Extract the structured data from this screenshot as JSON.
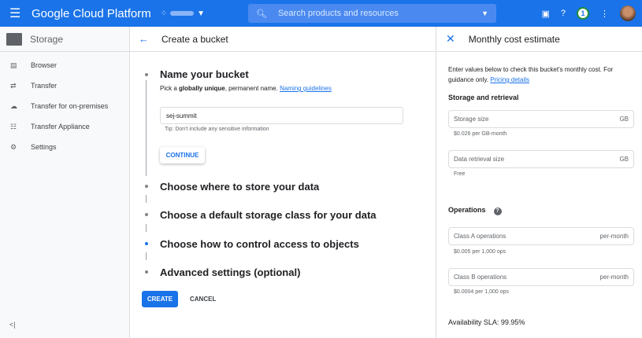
{
  "topbar": {
    "brand": "Google Cloud Platform",
    "search_placeholder": "Search products and resources",
    "notification_count": "1"
  },
  "sidebar": {
    "title": "Storage",
    "items": [
      {
        "label": "Browser",
        "icon": "bucket-icon"
      },
      {
        "label": "Transfer",
        "icon": "transfer-icon"
      },
      {
        "label": "Transfer for on-premises",
        "icon": "cloud-upload-icon"
      },
      {
        "label": "Transfer Appliance",
        "icon": "appliance-icon"
      },
      {
        "label": "Settings",
        "icon": "gear-icon"
      }
    ],
    "collapse": "<|"
  },
  "main": {
    "title": "Create a bucket",
    "steps": [
      "Name your bucket",
      "Choose where to store your data",
      "Choose a default storage class for your data",
      "Choose how to control access to objects",
      "Advanced settings (optional)"
    ],
    "subtitle_pre": "Pick a ",
    "subtitle_bold": "globally unique",
    "subtitle_post": ", permanent name. ",
    "naming_link": "Naming guidelines",
    "bucket_name": "sej-summit",
    "tip": "Tip: Don't include any sensitive information",
    "continue": "CONTINUE",
    "create": "CREATE",
    "cancel": "CANCEL"
  },
  "estimate": {
    "title": "Monthly cost estimate",
    "intro": "Enter values below to check this bucket's monthly cost. For guidance only. ",
    "pricing_link": "Pricing details",
    "storage_heading": "Storage and retrieval",
    "storage_size": "Storage size",
    "storage_unit": "GB",
    "storage_help": "$0.026 per GB-month",
    "retrieval_size": "Data retrieval size",
    "retrieval_unit": "GB",
    "retrieval_help": "Free",
    "operations_heading": "Operations",
    "class_a": "Class A operations",
    "class_a_unit": "per-month",
    "class_a_help": "$0.005 per 1,000 ops",
    "class_b": "Class B operations",
    "class_b_unit": "per-month",
    "class_b_help": "$0.0004 per 1,000 ops",
    "sla": "Availability SLA: 99.95%"
  }
}
